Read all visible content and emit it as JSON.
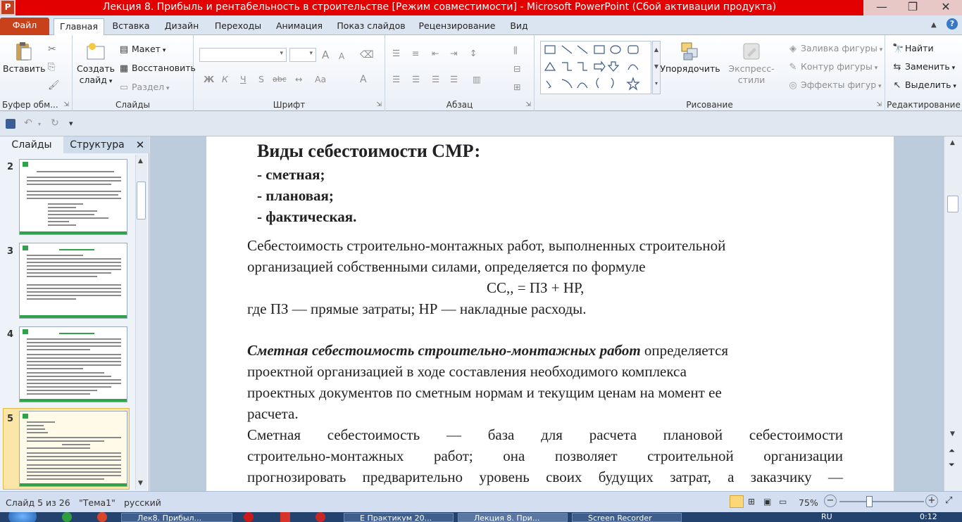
{
  "window": {
    "title": "Лекция 8. Прибыль и рентабельность в строительстве [Режим совместимости]  -  Microsoft PowerPoint (Сбой активации продукта)",
    "app_icon_letter": "P",
    "minimize_glyph": "—",
    "maximize_glyph": "❐",
    "close_glyph": "✕"
  },
  "ribbon_tabs": [
    "Файл",
    "Главная",
    "Вставка",
    "Дизайн",
    "Переходы",
    "Анимация",
    "Показ слайдов",
    "Рецензирование",
    "Вид"
  ],
  "ribbon": {
    "clipboard": {
      "paste": "Вставить",
      "label": "Буфер обм..."
    },
    "slides": {
      "new_slide_line1": "Создать",
      "new_slide_line2": "слайд",
      "layout": "Макет",
      "reset": "Восстановить",
      "section": "Раздел",
      "label": "Слайды"
    },
    "font": {
      "label": "Шрифт",
      "bold": "Ж",
      "italic": "К",
      "underline": "Ч",
      "strike": "S",
      "shadow": "abc",
      "grow": "A",
      "shrink": "A",
      "color": "A",
      "case": "Aa"
    },
    "paragraph": {
      "label": "Абзац"
    },
    "drawing": {
      "arrange": "Упорядочить",
      "quick_styles": "Экспресс-стили",
      "fill": "Заливка фигуры",
      "outline": "Контур фигуры",
      "effects": "Эффекты фигур",
      "label": "Рисование"
    },
    "editing": {
      "find": "Найти",
      "replace": "Заменить",
      "select": "Выделить",
      "label": "Редактирование"
    }
  },
  "panel": {
    "tab_slides": "Слайды",
    "tab_outline": "Структура",
    "close_glyph": "✕",
    "slide_numbers": [
      "2",
      "3",
      "4",
      "5"
    ]
  },
  "slide": {
    "heading": "Виды себестоимости СМР:",
    "bullets": [
      "- сметная;",
      "- плановая;",
      "- фактическая."
    ],
    "para1_line1": "Себестоимость строительно-монтажных работ, выполненных строительной",
    "para1_line2": "организацией собственными силами, определяется по формуле",
    "formula": "СС,, = ПЗ + НР,",
    "para1_line3": "где ПЗ — прямые затраты; НР — накладные расходы.",
    "para2_italic": "Сметная себестоимость строительно-монтажных работ",
    "para2_line1_rest": " определяется",
    "para2_line2": "проектной организацией в ходе составления необходимого комплекса",
    "para2_line3": "проектных документов по сметным нормам и текущим ценам на момент ее",
    "para2_line4": "расчета.",
    "para3_line1": "Сметная себестоимость — база для расчета плановой себестоимости",
    "para3_line2": "строительно-монтажных работ; она позволяет строительной организации",
    "para3_line3": "прогнозировать предварительно уровень своих будущих затрат, а заказчику —"
  },
  "status": {
    "slide_info": "Слайд 5 из 26",
    "theme": "\"Тема1\"",
    "language": "русский",
    "zoom": "75%",
    "zoom_out": "−",
    "zoom_in": "+"
  },
  "taskbar": {
    "items": [
      "Лек8. Прибыл...",
      "",
      "Е Практикум 20...",
      "Лекция 8. При...",
      "Screen Recorder"
    ],
    "lang": "RU",
    "clock": "0:12"
  },
  "colors": {
    "accent_red": "#e20000",
    "file_tab": "#c8411b",
    "thumb_green": "#31a24c"
  }
}
